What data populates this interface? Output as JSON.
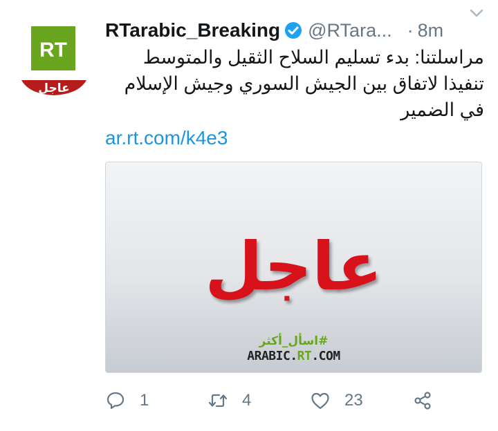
{
  "author": {
    "display_name": "RTarabic_Breaking",
    "handle": "@RTara...",
    "avatar_logo_text": "RT",
    "avatar_banner_text": "عاجل",
    "verified": true
  },
  "timestamp": {
    "separator": "·",
    "relative": "8m"
  },
  "tweet": {
    "text": "مراسلتنا: بدء تسليم السلاح الثقيل والمتوسط تنفيذا لاتفاق بين الجيش السوري وجيش الإسلام في الضمير",
    "link": "ar.rt.com/k4e3"
  },
  "card": {
    "headline": "عاجل",
    "hashtag": "#اسأل_أكثر",
    "site_prefix": "ARABIC.",
    "site_accent": "RT",
    "site_suffix": ".COM"
  },
  "actions": {
    "reply_count": "1",
    "retweet_count": "4",
    "like_count": "23"
  },
  "colors": {
    "link": "#1b95e0",
    "verified": "#1da1f2",
    "rt_green": "#6aa51f",
    "breaking_red": "#d8121b",
    "muted": "#657786"
  }
}
